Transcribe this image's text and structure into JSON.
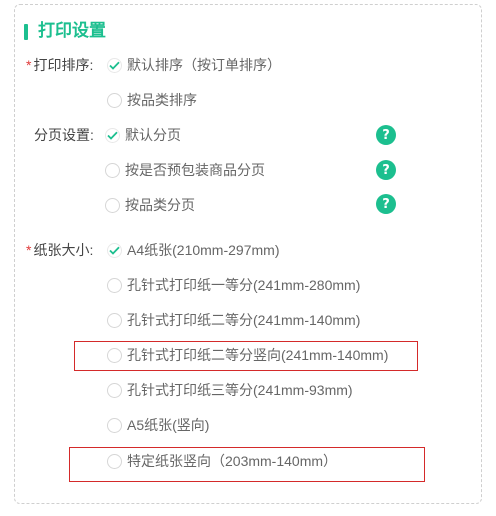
{
  "section": {
    "title": "打印设置"
  },
  "print_sort": {
    "label": "打印排序:",
    "required_mark": "*",
    "options": [
      {
        "label": "默认排序（按订单排序）",
        "checked": true
      },
      {
        "label": "按品类排序",
        "checked": false
      }
    ]
  },
  "page_break": {
    "label": "分页设置:",
    "options": [
      {
        "label": "默认分页",
        "checked": true
      },
      {
        "label": "按是否预包装商品分页",
        "checked": false
      },
      {
        "label": "按品类分页",
        "checked": false
      }
    ],
    "help_glyph": "?"
  },
  "paper_size": {
    "label": "纸张大小:",
    "required_mark": "*",
    "options": [
      {
        "label": "A4纸张(210mm-297mm)",
        "checked": true
      },
      {
        "label": "孔针式打印纸一等分(241mm-280mm)",
        "checked": false
      },
      {
        "label": "孔针式打印纸二等分(241mm-140mm)",
        "checked": false
      },
      {
        "label": "孔针式打印纸二等分竖向(241mm-140mm)",
        "checked": false,
        "highlighted": true
      },
      {
        "label": "孔针式打印纸三等分(241mm-93mm)",
        "checked": false
      },
      {
        "label": "A5纸张(竖向)",
        "checked": false
      },
      {
        "label": "特定纸张竖向（203mm-140mm）",
        "checked": false,
        "highlighted": true
      }
    ]
  },
  "colors": {
    "accent": "#1cbf8f",
    "required": "#e03a3a",
    "highlight_box": "#d42a2a"
  }
}
